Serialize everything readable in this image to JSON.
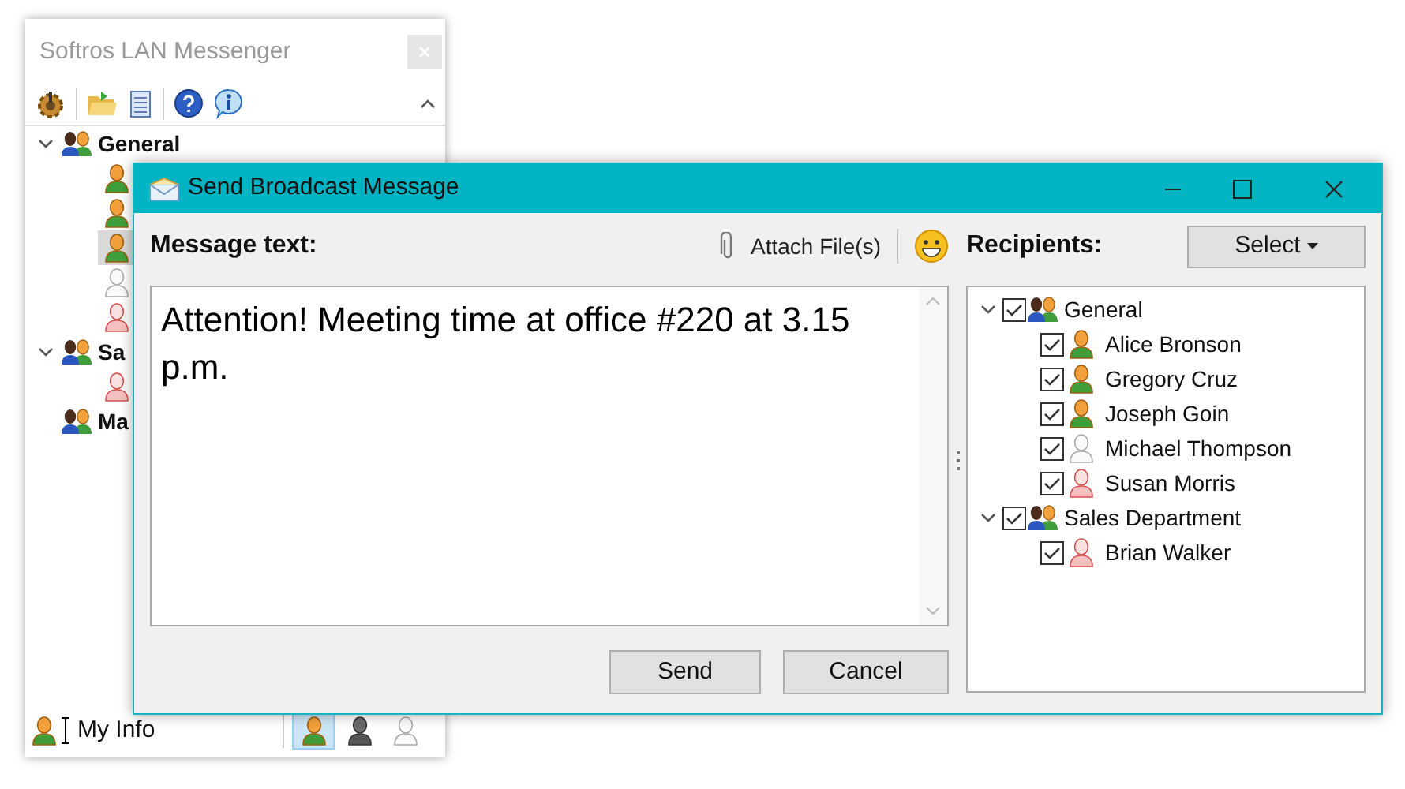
{
  "main_window": {
    "title": "Softros LAN Messenger",
    "contacts": [
      {
        "label": "General",
        "expanded": true,
        "children": [
          {
            "kind": "online",
            "selected": false
          },
          {
            "kind": "online",
            "selected": false
          },
          {
            "kind": "online",
            "selected": true
          },
          {
            "kind": "offline",
            "selected": false
          },
          {
            "kind": "busy",
            "selected": false
          }
        ]
      },
      {
        "label": "Sa",
        "expanded": true,
        "children": [
          {
            "kind": "busy",
            "selected": false
          }
        ]
      },
      {
        "label": "Ma",
        "expanded": false
      }
    ],
    "my_info": "My Info",
    "status_buttons": [
      {
        "kind": "online",
        "selected": true
      },
      {
        "kind": "away",
        "selected": false
      },
      {
        "kind": "offline",
        "selected": false
      }
    ]
  },
  "dialog": {
    "title": "Send Broadcast Message",
    "message_label": "Message text:",
    "attach_label": "Attach File(s)",
    "message": "Attention! Meeting time at office #220 at 3.15 p.m.",
    "recipients_label": "Recipients:",
    "select_button": "Select",
    "recipients": [
      {
        "label": "General",
        "expanded": true,
        "checked": true,
        "children": [
          {
            "label": "Alice Bronson",
            "kind": "online",
            "checked": true
          },
          {
            "label": "Gregory Cruz",
            "kind": "online",
            "checked": true
          },
          {
            "label": "Joseph Goin",
            "kind": "online",
            "checked": true
          },
          {
            "label": "Michael Thompson",
            "kind": "offline",
            "checked": true
          },
          {
            "label": "Susan Morris",
            "kind": "busy",
            "checked": true
          }
        ]
      },
      {
        "label": "Sales Department",
        "expanded": true,
        "checked": true,
        "children": [
          {
            "label": "Brian Walker",
            "kind": "busy",
            "checked": true
          }
        ]
      }
    ],
    "buttons": [
      "Send",
      "Cancel"
    ]
  }
}
